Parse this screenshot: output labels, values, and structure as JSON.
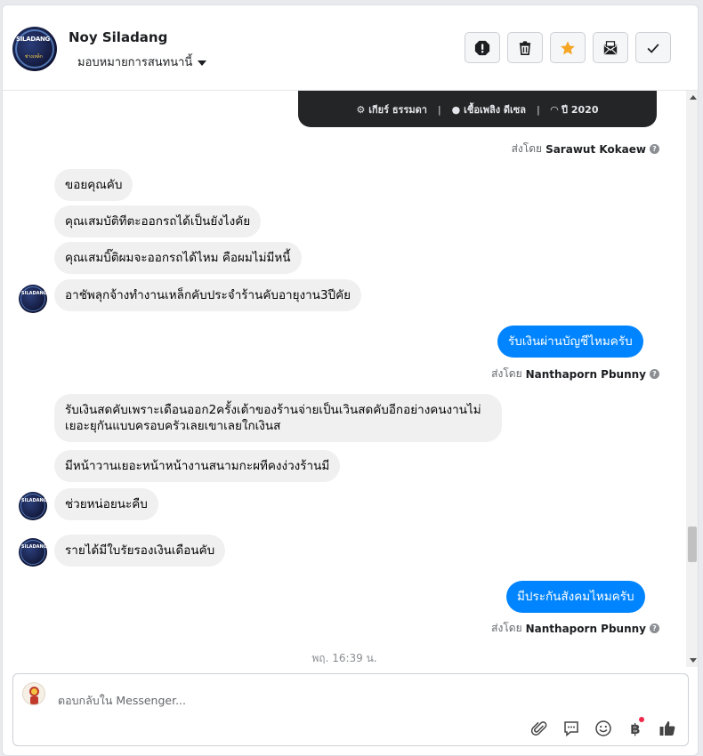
{
  "header": {
    "name": "Noy Siladang",
    "assign_label": "มอบหมายการสนทนานี้",
    "avatar_text": "SILADANG",
    "avatar_sub": "ช่างเหล็ก"
  },
  "card": {
    "gear": "เกียร์ ธรรมดา",
    "fuel": "เชื้อเพลิง ดีเซล",
    "year": "ปี 2020"
  },
  "sent_by_label": "ส่งโดย",
  "messages": {
    "sent1_name": "Sarawut Kokaew",
    "in1": "ขอยคุณคับ",
    "in2": "คุณเสมบัติทีตะออกรถได้เป็นยังไงคัย",
    "in3": "คุณเสมบิ๊ติผมจะออกรถได้ไหม  คือผมไม่มีหนี้",
    "in4": "อาชัพลุกจ้างทำงานเหล็กคับประจำร้านคับอายุงาน3ปีคัย",
    "out1": "รับเงินผ่านบัญชีไหมครับ",
    "sent2_name": "Nanthaporn Pbunny",
    "in5": "รับเงินสดคับเพราะเดือนออก2ครั้งเต้าของร้านจ่ายเป็นเวินสดคับอีกอย่างคนงานไม่เยอะยุกันแบบครอบครัวเลยเขาเลยใกเงินส",
    "in6": "มีหน้าวานเยอะหน้าหน้างานสนามกะผทีคงง่วงร้านมี",
    "in7": "ช่วยหน่อยนะคืบ",
    "in8": "รายได้มีใบรัยรองเงินเดือนคับ",
    "out2": "มีประกันสังคมไหมครับ",
    "sent3_name": "Nanthaporn Pbunny",
    "time": "พฤ. 16:39 น."
  },
  "composer": {
    "placeholder": "ตอบกลับใน Messenger...",
    "baht": "฿"
  },
  "colors": {
    "accent": "#0084ff",
    "incoming_bubble": "#f0f0f0",
    "star": "#f5a623",
    "badge": "#f02849"
  },
  "icons": [
    "alert-icon",
    "trash-icon",
    "star-icon",
    "mark-unread-icon",
    "check-icon",
    "attach-icon",
    "sticker-icon",
    "emoji-icon",
    "payment-icon",
    "like-icon"
  ]
}
